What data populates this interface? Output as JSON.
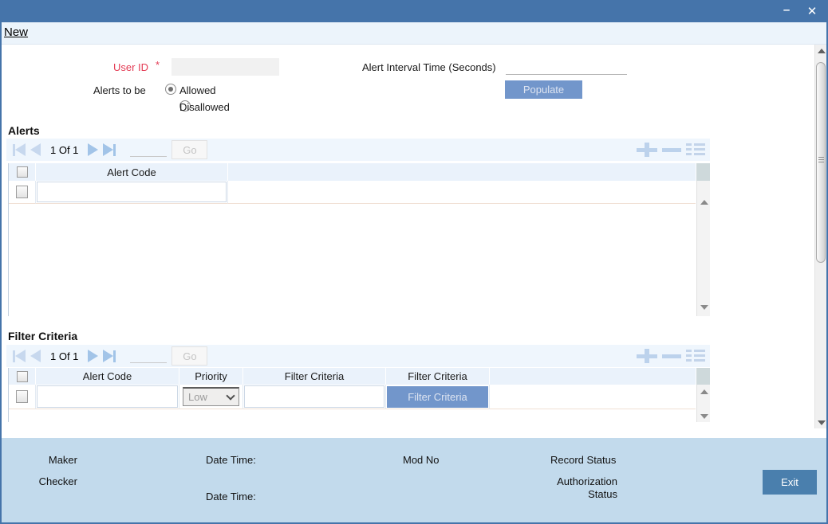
{
  "window": {
    "minimize_icon": "–",
    "close_icon": "✕"
  },
  "menubar": {
    "new_label": "New"
  },
  "form": {
    "user_id_label": "User ID",
    "required_marker": "*",
    "user_id_value": "",
    "alert_interval_label": "Alert Interval Time (Seconds)",
    "alert_interval_value": "",
    "alerts_to_be_label": "Alerts to be",
    "allowed_label": "Allowed",
    "disallowed_label": "Disallowed",
    "populate_label": "Populate"
  },
  "alerts_section": {
    "title": "Alerts",
    "pagination": {
      "page_text": "1 Of 1",
      "page_input_value": "",
      "go_label": "Go"
    },
    "columns": {
      "alert_code": "Alert Code"
    },
    "rows": [
      {
        "alert_code": ""
      }
    ]
  },
  "filter_section": {
    "title": "Filter Criteria",
    "pagination": {
      "page_text": "1 Of 1",
      "page_input_value": "",
      "go_label": "Go"
    },
    "columns": {
      "alert_code": "Alert Code",
      "priority": "Priority",
      "filter_criteria": "Filter Criteria",
      "filter_criteria_btn": "Filter Criteria"
    },
    "rows": [
      {
        "alert_code": "",
        "priority": "Low",
        "filter_criteria": "",
        "filter_button_label": "Filter Criteria"
      }
    ]
  },
  "footer": {
    "maker_label": "Maker",
    "checker_label": "Checker",
    "date_time_label": "Date Time:",
    "date_time_label_2": "Date Time:",
    "mod_no_label": "Mod No",
    "record_status_label": "Record Status",
    "authorization_status_label": "Authorization Status",
    "exit_label": "Exit"
  },
  "colors": {
    "titlebar": "#4574aa",
    "accent_button": "#7296cb",
    "exit_button": "#4a7fad",
    "footer_bg": "#c2daec",
    "required_red": "#e33b54",
    "pale_arrow": "#c7d8ee",
    "dark_arrow": "#a2c4e8"
  }
}
